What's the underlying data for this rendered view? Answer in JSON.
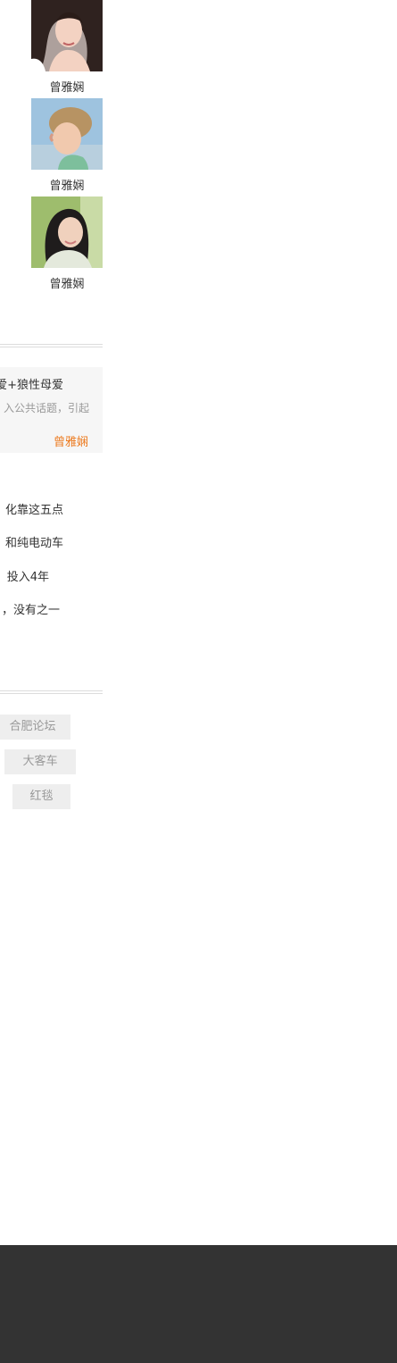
{
  "authors": [
    {
      "name": "曾雅娴",
      "photo": "author-photo-woman"
    },
    {
      "name": "曾雅娴",
      "photo": "author-photo-child"
    },
    {
      "name": "曾雅娴",
      "photo": "author-photo-woman-outdoor"
    }
  ],
  "featured": {
    "title": "爱+狼性母爱",
    "summary": "入公共话题，引起",
    "author": "曾雅娴"
  },
  "news": [
    "化靠这五点",
    "和纯电动车",
    "投入4年",
    "，没有之一"
  ],
  "tags": [
    "合肥论坛",
    "大客车",
    "红毯"
  ],
  "colors": {
    "accent_orange": "#ec7a1f",
    "footer_dark": "#333333",
    "tag_background": "#eeeeee"
  }
}
